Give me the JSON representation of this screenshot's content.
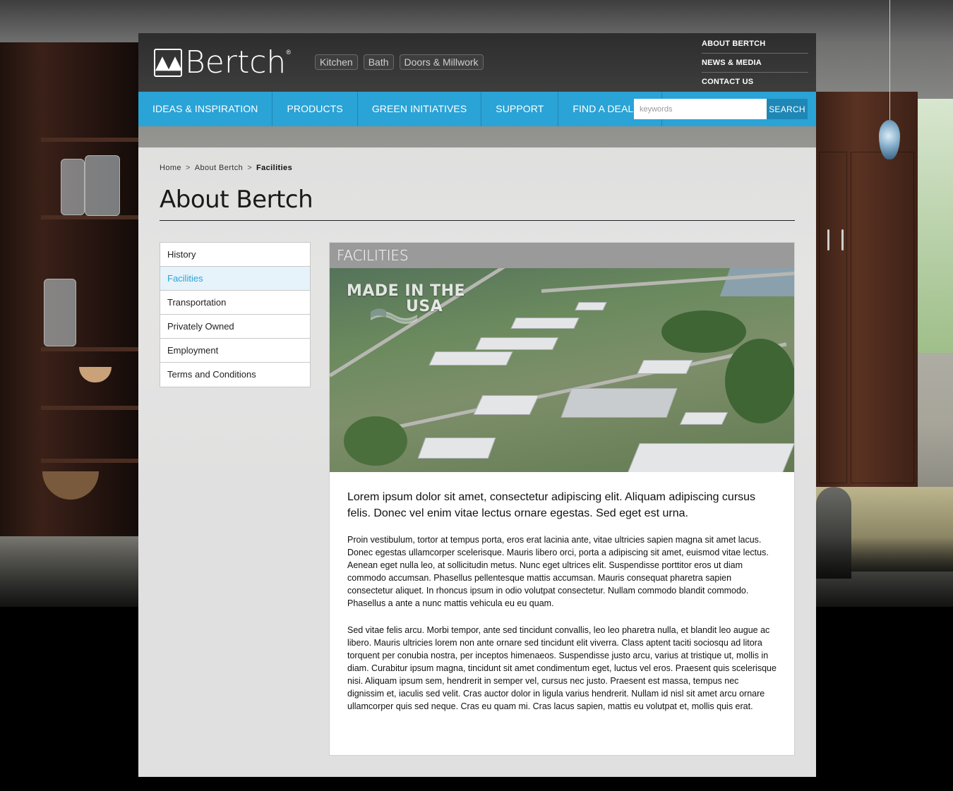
{
  "brand": {
    "name": "Bertch",
    "registered": "®"
  },
  "site_links": [
    {
      "label": "Kitchen"
    },
    {
      "label": "Bath"
    },
    {
      "label": "Doors & Millwork"
    }
  ],
  "utility_nav": [
    {
      "label": "ABOUT BERTCH"
    },
    {
      "label": "NEWS & MEDIA"
    },
    {
      "label": "CONTACT US"
    }
  ],
  "main_nav": [
    {
      "label": "IDEAS & INSPIRATION"
    },
    {
      "label": "PRODUCTS"
    },
    {
      "label": "GREEN INITIATIVES"
    },
    {
      "label": "SUPPORT"
    },
    {
      "label": "FIND A DEALER"
    }
  ],
  "search": {
    "placeholder": "keywords",
    "button_label": "SEARCH"
  },
  "breadcrumb": {
    "items": [
      "Home",
      "About Bertch"
    ],
    "separator": ">",
    "current": "Facilities"
  },
  "page": {
    "title": "About Bertch"
  },
  "sub_nav": {
    "active_index": 1,
    "items": [
      {
        "label": "History"
      },
      {
        "label": "Facilities"
      },
      {
        "label": "Transportation"
      },
      {
        "label": "Privately Owned"
      },
      {
        "label": "Employment"
      },
      {
        "label": "Terms and Conditions"
      }
    ]
  },
  "article": {
    "heading": "FACILITIES",
    "hero_badge_line1": "MADE IN THE",
    "hero_badge_line2": "USA",
    "lead": "Lorem ipsum dolor sit amet, consectetur adipiscing elit. Aliquam adipiscing cursus felis. Donec vel enim vitae lectus ornare egestas. Sed eget est urna.",
    "paragraphs": [
      "Proin vestibulum, tortor at tempus porta, eros erat lacinia ante, vitae ultricies sapien magna sit amet lacus. Donec egestas ullamcorper scelerisque. Mauris libero orci, porta a adipiscing sit amet, euismod vitae lectus. Aenean eget nulla leo, at sollicitudin metus. Nunc eget ultrices elit. Suspendisse porttitor eros ut diam commodo accumsan. Phasellus pellentesque mattis accumsan. Mauris consequat pharetra sapien consectetur aliquet. In rhoncus ipsum in odio volutpat consectetur. Nullam commodo blandit commodo. Phasellus a ante a nunc mattis vehicula eu eu quam.",
      "Sed vitae felis arcu. Morbi tempor, ante sed tincidunt convallis, leo leo pharetra nulla, et blandit leo augue ac libero. Mauris ultricies lorem non ante ornare sed tincidunt elit viverra. Class aptent taciti sociosqu ad litora torquent per conubia nostra, per inceptos himenaeos. Suspendisse justo arcu, varius at tristique ut, mollis in diam. Curabitur ipsum magna, tincidunt sit amet condimentum eget, luctus vel eros. Praesent quis scelerisque nisi. Aliquam ipsum sem, hendrerit in semper vel, cursus nec justo. Praesent est massa, tempus nec dignissim et, iaculis sed velit. Cras auctor dolor in ligula varius hendrerit. Nullam id nisl sit amet arcu ornare ullamcorper quis sed neque. Cras eu quam mi. Cras lacus sapien, mattis eu volutpat et, mollis quis erat."
    ]
  },
  "colors": {
    "accent": "#2aa3d6",
    "accent_dark": "#1e87b6",
    "topbar": "#333333",
    "article_header": "#9a9a9a",
    "active_subnav_bg": "#e6f3fa"
  },
  "icons": {
    "logo_mark": "bertch-logo-mark",
    "hero_flag": "us-flag-icon"
  }
}
